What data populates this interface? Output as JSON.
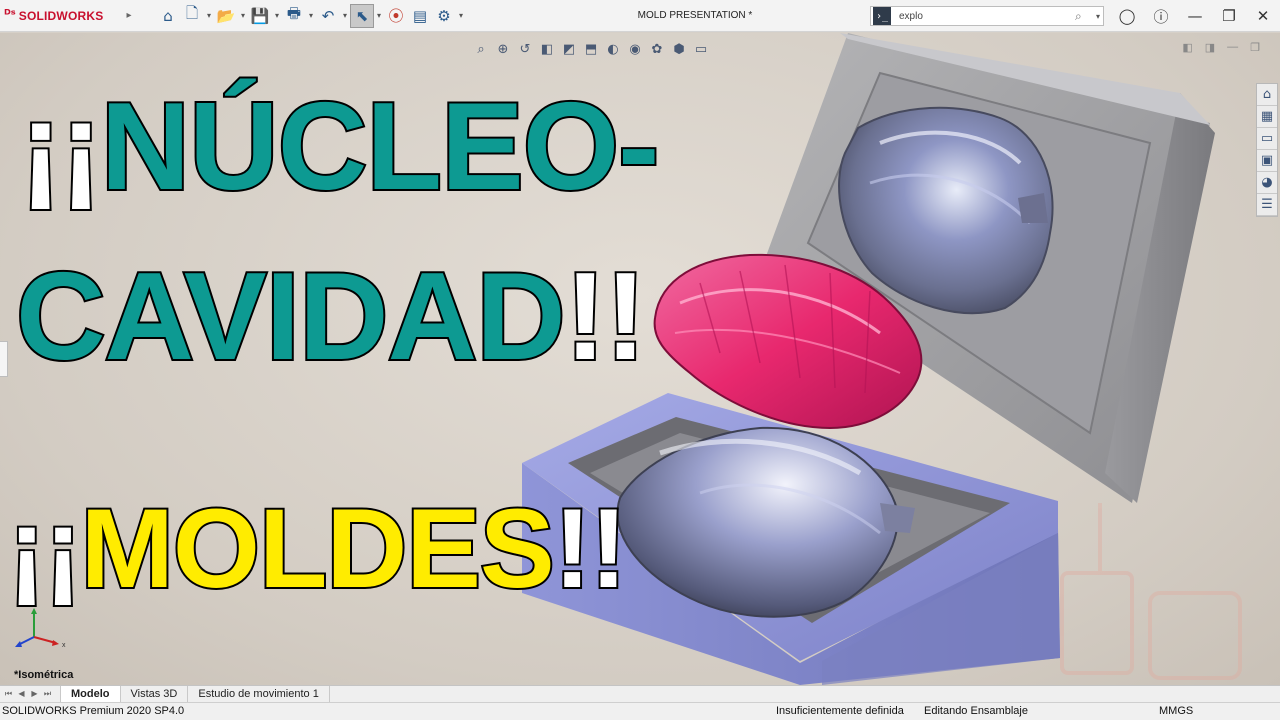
{
  "app": {
    "brand": "SOLIDWORKS",
    "document_title": "MOLD PRESENTATION *"
  },
  "search": {
    "value": "explo",
    "command_icon": "command-icon"
  },
  "headline": {
    "line1_bangs": "¡¡",
    "line1_text": "NÚCLEO-",
    "line2_text": "CAVIDAD",
    "line2_bangs": "!!",
    "line3_bangs_open": "¡¡",
    "line3_text": "MOLDES",
    "line3_bangs_close": "!!"
  },
  "view": {
    "orientation_label": "*Isométrica"
  },
  "tabs": [
    "Modelo",
    "Vistas 3D",
    "Estudio de movimiento 1"
  ],
  "status": {
    "product": "SOLIDWORKS Premium 2020 SP4.0",
    "definition": "Insuficientemente definida",
    "mode": "Editando Ensamblaje",
    "units": "MMGS"
  },
  "colors": {
    "headline_teal": "#0d9a92",
    "headline_yellow": "#ffec00",
    "shell_pink": "#e8286e",
    "mold_blue": "#8f95d8",
    "brand_red": "#c8102e"
  }
}
